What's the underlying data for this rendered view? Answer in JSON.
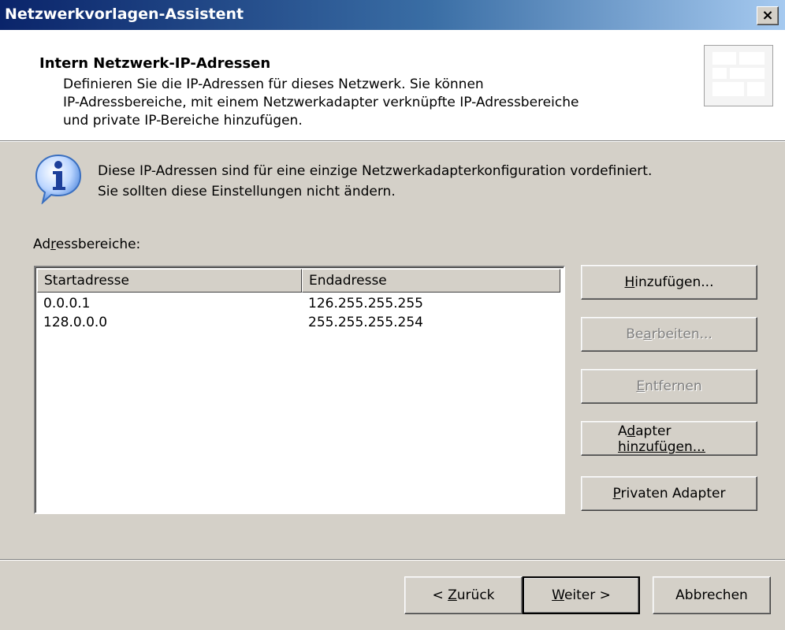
{
  "window": {
    "title": "Netzwerkvorlagen-Assistent",
    "close_label": "×"
  },
  "header": {
    "title": "Intern Netzwerk-IP-Adressen",
    "desc_line1": "Definieren Sie die IP-Adressen für dieses Netzwerk. Sie können",
    "desc_line2": "IP-Adressbereiche, mit einem Netzwerkadapter verknüpfte IP-Adressbereiche",
    "desc_line3": "und private IP-Bereiche hinzufügen."
  },
  "info": {
    "icon": "info-icon",
    "line1": "Diese IP-Adressen sind für eine einzige Netzwerkadapterkonfiguration vordefiniert.",
    "line2": "Sie sollten diese Einstellungen nicht ändern."
  },
  "ranges": {
    "label_pre": "Ad",
    "label_ul": "r",
    "label_post": "essbereiche:",
    "columns": {
      "start": "Startadresse",
      "end": "Endadresse"
    },
    "rows": [
      {
        "start": "0.0.0.1",
        "end": "126.255.255.255"
      },
      {
        "start": "128.0.0.0",
        "end": "255.255.255.254"
      }
    ]
  },
  "buttons": {
    "add": {
      "ul": "H",
      "rest": "inzufügen..."
    },
    "edit": {
      "pre": "Be",
      "ul": "a",
      "rest": "rbeiten..."
    },
    "remove": {
      "ul": "E",
      "rest": "ntfernen"
    },
    "adapter_line1_pre": "A",
    "adapter_line1_ul": "d",
    "adapter_line1_rest": "apter",
    "adapter_line2": "hinzufügen...",
    "private": {
      "ul": "P",
      "rest": "rivaten Adapter"
    }
  },
  "nav": {
    "back": {
      "pre": "< ",
      "ul": "Z",
      "rest": "urück"
    },
    "next": {
      "ul": "W",
      "rest": "eiter >"
    },
    "cancel": "Abbrechen"
  }
}
